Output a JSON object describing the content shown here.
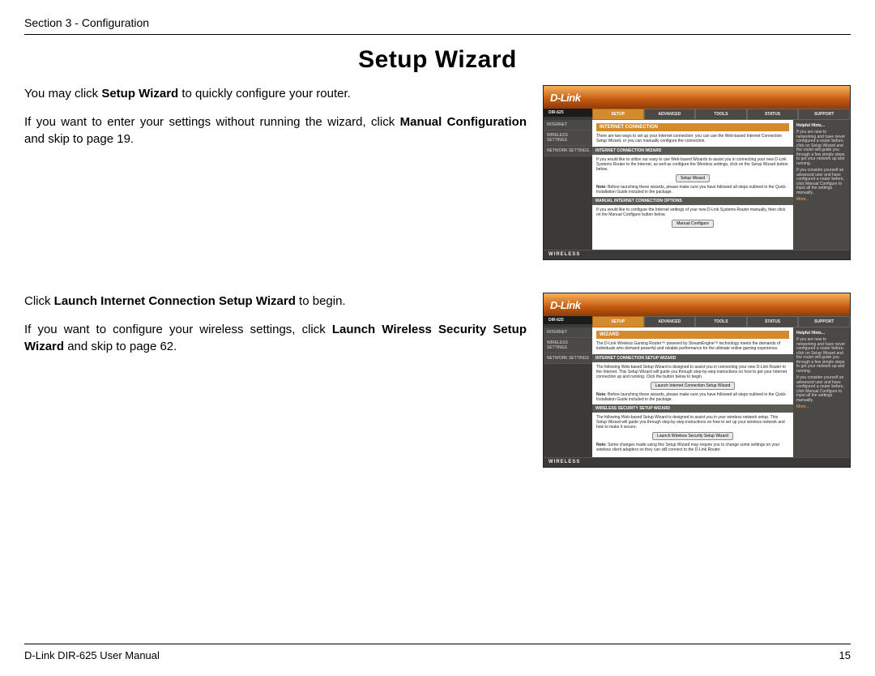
{
  "header": {
    "section": "Section 3 - Configuration"
  },
  "title": "Setup Wizard",
  "block1": {
    "p1_a": "You may click ",
    "p1_b": "Setup Wizard",
    "p1_c": " to quickly configure your router.",
    "p2_a": "If you want to enter your settings without running the wizard, click ",
    "p2_b": "Manual Configuration",
    "p2_c": " and skip to page 19."
  },
  "block2": {
    "p1_a": "Click ",
    "p1_b": "Launch Internet Connection Setup Wizard",
    "p1_c": " to begin.",
    "p2_a": "If you want to configure your wireless settings, click ",
    "p2_b": "Launch Wireless Security Setup Wizard",
    "p2_c": " and skip to page 62."
  },
  "router_common": {
    "logo": "D-Link",
    "model": "DIR-625",
    "tabs": [
      "SETUP",
      "ADVANCED",
      "TOOLS",
      "STATUS",
      "SUPPORT"
    ],
    "sidenav": [
      "INTERNET",
      "WIRELESS SETTINGS",
      "NETWORK SETTINGS"
    ],
    "hints_title": "Helpful Hints...",
    "more": "More...",
    "footer": "WIRELESS"
  },
  "shot1": {
    "head": "INTERNET CONNECTION",
    "intro": "There are two ways to set up your Internet connection: you can use the Web-based Internet Connection Setup Wizard, or you can manually configure the connection.",
    "sub1": "INTERNET CONNECTION WIZARD",
    "txt1": "If you would like to utilize our easy to use Web-based Wizards to assist you in connecting your new D-Link Systems Router to the Internet, as well as configure the Wireless settings, click on the Setup Wizard button below.",
    "btn1": "Setup Wizard",
    "note1_b": "Note:",
    "note1": " Before launching these wizards, please make sure you have followed all steps outlined in the Quick Installation Guide included in the package.",
    "sub2": "MANUAL INTERNET CONNECTION OPTIONS",
    "txt2": "If you would like to configure the Internet settings of your new D-Link Systems Router manually, then click on the Manual Configure button below.",
    "btn2": "Manual Configure",
    "hints1": "If you are new to networking and have never configured a router before, click on Setup Wizard and the router will guide you through a few simple steps to get your network up and running.",
    "hints2": "If you consider yourself an advanced user and have configured a router before, click Manual Configure to input all the settings manually."
  },
  "shot2": {
    "head": "WIZARD",
    "intro": "The D-Link Wireless Gaming Router™ powered by StreamEngine™ technology meets the demands of individuals who demand powerful and reliable performance for the ultimate online gaming experience.",
    "sub1": "INTERNET CONNECTION SETUP WIZARD",
    "txt1": "The following Web-based Setup Wizard is designed to assist you in connecting your new D-Link Router to the Internet. This Setup Wizard will guide you through step-by-step instructions on how to get your Internet connection up and running. Click the button below to begin.",
    "btn1": "Launch Internet Connection Setup Wizard",
    "note1_b": "Note:",
    "note1": " Before launching these wizards, please make sure you have followed all steps outlined in the Quick Installation Guide included in the package.",
    "sub2": "WIRELESS SECURITY SETUP WIZARD",
    "txt2": "The following Web-based Setup Wizard is designed to assist you in your wireless network setup. This Setup Wizard will guide you through step-by-step instructions on how to set up your wireless network and how to make it secure.",
    "btn2": "Launch Wireless Security Setup Wizard",
    "note2_b": "Note:",
    "note2": " Some changes made using this Setup Wizard may require you to change some settings on your wireless client adapters so they can still connect to the D-Link Router.",
    "hints1": "If you are new to networking and have never configured a router before, click on Setup Wizard and the router will guide you through a few simple steps to get your network up and running.",
    "hints2": "If you consider yourself an advanced user and have configured a router before, click Manual Configure to input all the settings manually."
  },
  "footer": {
    "left": "D-Link DIR-625 User Manual",
    "right": "15"
  }
}
